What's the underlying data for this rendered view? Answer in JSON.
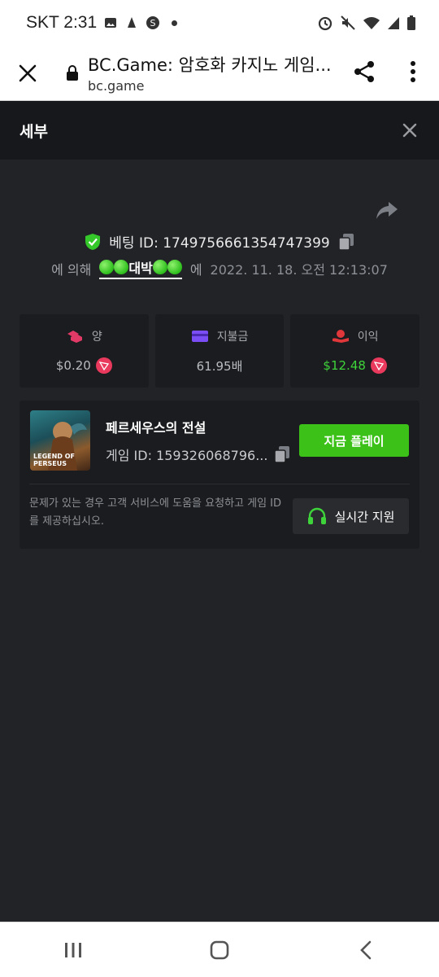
{
  "status_bar": {
    "carrier_time": "SKT 2:31",
    "icons": [
      "image-icon",
      "notification-icon",
      "s-app-icon",
      "dot-icon",
      "alarm-icon",
      "mute-icon",
      "wifi-icon",
      "signal-icon",
      "battery-icon"
    ]
  },
  "browser": {
    "title": "BC.Game: 암호화 카지노 게임...",
    "url": "bc.game"
  },
  "modal": {
    "title": "세부"
  },
  "bet": {
    "id_label": "베팅 ID: 1749756661354747399",
    "by_label": "에 의해",
    "username": "대박",
    "at_label": "에",
    "timestamp": "2022. 11. 18. 오전 12:13:07"
  },
  "stats": [
    {
      "label": "양",
      "value": "$0.20",
      "icon": "coins-icon",
      "color": "#e9395d"
    },
    {
      "label": "지불금",
      "value": "61.95배",
      "icon": "card-icon",
      "color": "#7a4df5"
    },
    {
      "label": "이익",
      "value": "$12.48",
      "icon": "profit-icon",
      "color": "#e0373b"
    }
  ],
  "game": {
    "name": "페르세우스의 전설",
    "id_label": "게임 ID: 159326068796...",
    "thumb_text": "LEGEND OF PERSEUS",
    "play_label": "지금 플레이"
  },
  "help": {
    "text": "문제가 있는 경우 고객 서비스에 도움을 요청하고 게임 ID를 제공하십시오.",
    "support_label": "실시간 지원"
  },
  "colors": {
    "accent_green": "#3bc117",
    "profit_green": "#3ed33b",
    "coin_red": "#e9395d",
    "background": "#222327",
    "card": "#1b1c1f"
  }
}
